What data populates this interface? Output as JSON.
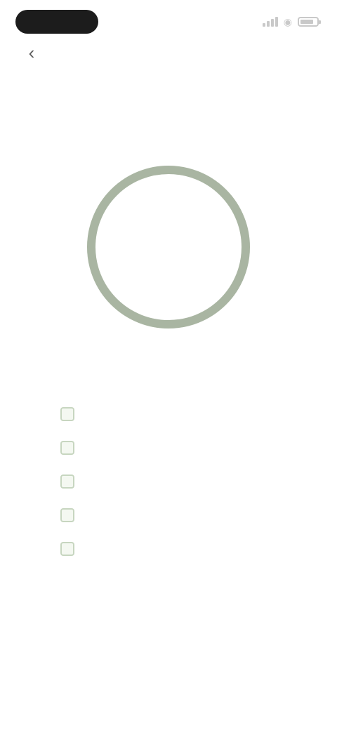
{
  "status_bar": {
    "time": "",
    "icons": [
      "cellular-signal-icon",
      "wifi-icon",
      "battery-icon"
    ]
  },
  "header": {
    "back_icon": "chevron-left-icon",
    "title": "",
    "subtitle": ""
  },
  "session": {
    "label": ""
  },
  "timer": {
    "readout": "",
    "progress": 1.0,
    "ring_color": "#a9b5a2",
    "track_color": "#e7ebe4"
  },
  "steps": [
    {
      "text": "",
      "checked": false
    },
    {
      "text": "",
      "checked": false
    },
    {
      "text": "",
      "checked": false
    },
    {
      "text": "",
      "checked": false
    },
    {
      "text": "",
      "checked": false
    }
  ],
  "colors": {
    "accent": "#8ea486",
    "background": "#ffffff",
    "status_pill": "#1c1c1c"
  }
}
